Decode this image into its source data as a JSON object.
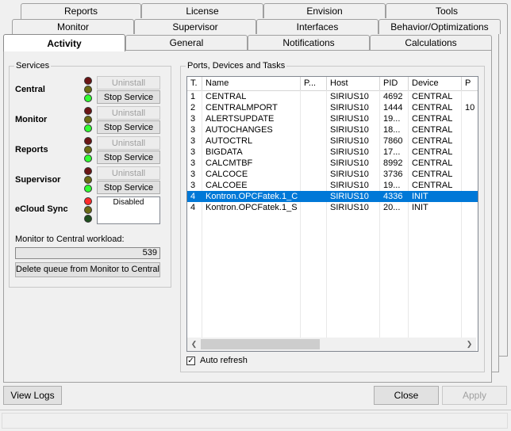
{
  "tabs_row1": [
    "Reports",
    "License",
    "Envision",
    "Tools"
  ],
  "tabs_row2": [
    "Monitor",
    "Supervisor",
    "Interfaces",
    "Behavior/Optimizations"
  ],
  "tabs_row3": [
    "Activity",
    "General",
    "Notifications",
    "Calculations"
  ],
  "services": {
    "title": "Services",
    "uninstall_label": "Uninstall",
    "stop_label": "Stop Service",
    "items": [
      {
        "name": "Central"
      },
      {
        "name": "Monitor"
      },
      {
        "name": "Reports"
      },
      {
        "name": "Supervisor"
      }
    ],
    "ecloud": {
      "name": "eCloud Sync",
      "status": "Disabled"
    },
    "workload_label": "Monitor to Central workload:",
    "workload_value": "539",
    "delete_queue_label": "Delete queue from Monitor to Central"
  },
  "ports": {
    "title": "Ports, Devices and Tasks",
    "columns": [
      "T.",
      "Name",
      "P...",
      "Host",
      "PID",
      "Device",
      "P"
    ],
    "rows": [
      [
        "1",
        "CENTRAL",
        "",
        "SIRIUS10",
        "4692",
        "CENTRAL",
        ""
      ],
      [
        "2",
        "CENTRALMPORT",
        "",
        "SIRIUS10",
        "1444",
        "CENTRAL",
        "10"
      ],
      [
        "3",
        "ALERTSUPDATE",
        "",
        "SIRIUS10",
        "19...",
        "CENTRAL",
        ""
      ],
      [
        "3",
        "AUTOCHANGES",
        "",
        "SIRIUS10",
        "18...",
        "CENTRAL",
        ""
      ],
      [
        "3",
        "AUTOCTRL",
        "",
        "SIRIUS10",
        "7860",
        "CENTRAL",
        ""
      ],
      [
        "3",
        "BIGDATA",
        "",
        "SIRIUS10",
        "17...",
        "CENTRAL",
        ""
      ],
      [
        "3",
        "CALCMTBF",
        "",
        "SIRIUS10",
        "8992",
        "CENTRAL",
        ""
      ],
      [
        "3",
        "CALCOCE",
        "",
        "SIRIUS10",
        "3736",
        "CENTRAL",
        ""
      ],
      [
        "3",
        "CALCOEE",
        "",
        "SIRIUS10",
        "19...",
        "CENTRAL",
        ""
      ],
      [
        "4",
        "Kontron.OPCFatek.1_C",
        "",
        "SIRIUS10",
        "4336",
        "INIT",
        ""
      ],
      [
        "4",
        "Kontron.OPCFatek.1_S",
        "",
        "SIRIUS10",
        "20...",
        "INIT",
        ""
      ]
    ],
    "selected_row": 9,
    "auto_refresh_label": "Auto refresh",
    "auto_refresh_checked": true
  },
  "footer": {
    "view_logs_label": "View Logs",
    "close_label": "Close",
    "apply_label": "Apply"
  }
}
